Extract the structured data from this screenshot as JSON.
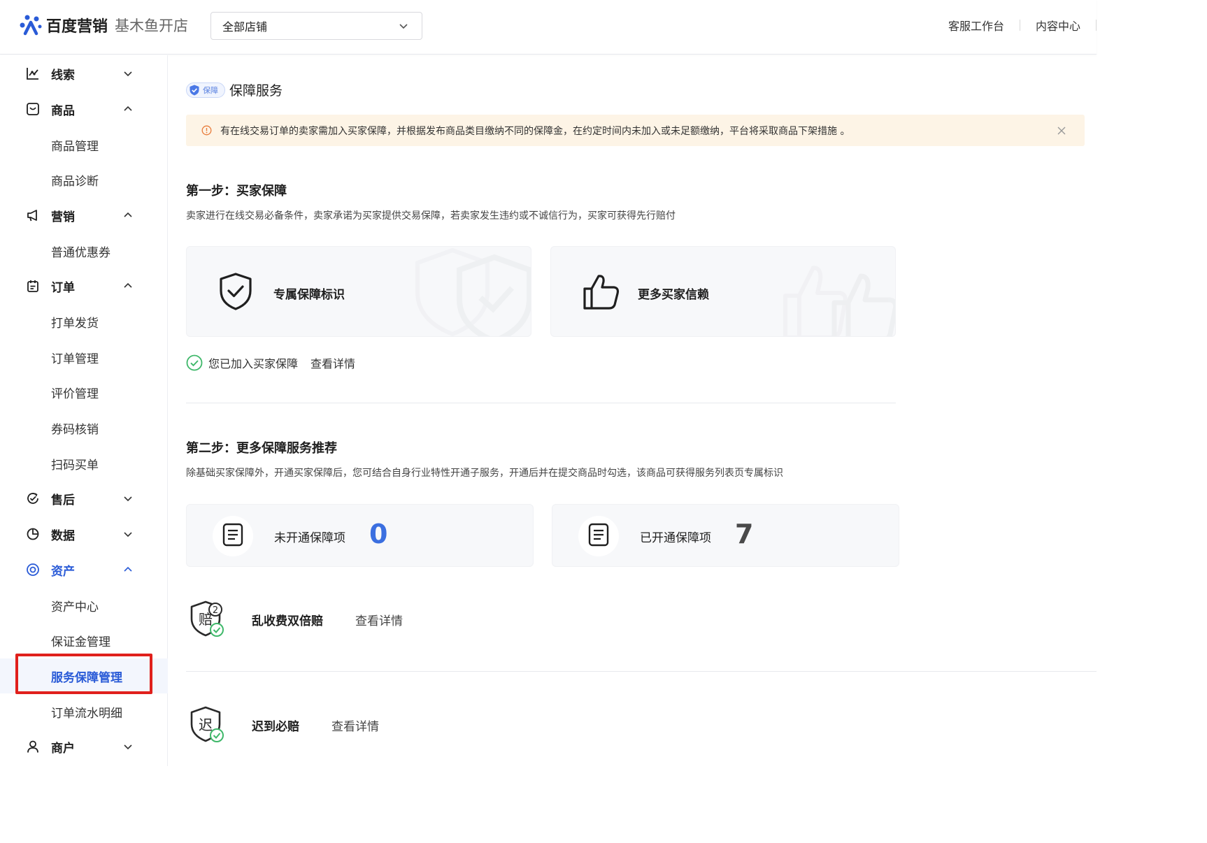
{
  "header": {
    "logo_main": "百度营销",
    "logo_sub": "基木鱼开店",
    "shop_select": "全部店铺",
    "links": [
      "客服工作台",
      "内容中心"
    ]
  },
  "sidebar": {
    "groups": [
      {
        "label": "线索",
        "icon": "chart-line-icon",
        "expanded": false
      },
      {
        "label": "商品",
        "icon": "product-box-icon",
        "expanded": true,
        "items": [
          "商品管理",
          "商品诊断"
        ]
      },
      {
        "label": "营销",
        "icon": "megaphone-icon",
        "expanded": true,
        "items": [
          "普通优惠券"
        ]
      },
      {
        "label": "订单",
        "icon": "order-clipboard-icon",
        "expanded": true,
        "items": [
          "打单发货",
          "订单管理",
          "评价管理",
          "券码核销",
          "扫码买单"
        ]
      },
      {
        "label": "售后",
        "icon": "after-sale-icon",
        "expanded": false
      },
      {
        "label": "数据",
        "icon": "pie-chart-icon",
        "expanded": false
      },
      {
        "label": "资产",
        "icon": "asset-icon",
        "expanded": true,
        "active": true,
        "items": [
          "资产中心",
          "保证金管理",
          "服务保障管理",
          "订单流水明细"
        ]
      },
      {
        "label": "商户",
        "icon": "user-icon",
        "expanded": false
      }
    ],
    "selected_item": "服务保障管理"
  },
  "main": {
    "title_badge": "保障",
    "title": "保障服务",
    "notice": "有在线交易订单的卖家需加入买家保障，并根据发布商品类目缴纳不同的保障金，在约定时间内未加入或未足额缴纳，平台将采取商品下架措施 。",
    "step1": {
      "title": "第一步：买家保障",
      "desc": "卖家进行在线交易必备条件，卖家承诺为买家提供交易保障，若卖家发生违约或不诚信行为，买家可获得先行赔付",
      "cards": [
        {
          "label": "专属保障标识",
          "icon": "shield-check-icon"
        },
        {
          "label": "更多买家信赖",
          "icon": "thumbs-up-icon"
        }
      ],
      "joined_text": "您已加入买家保障",
      "details_link": "查看详情"
    },
    "step2": {
      "title": "第二步：更多保障服务推荐",
      "desc": "除基础买家保障外，开通买家保障后，您可结合自身行业特性开通子服务，开通后并在提交商品时勾选，该商品可获得服务列表页专属标识",
      "stats": [
        {
          "label": "未开通保障项",
          "value": "0",
          "color": "#3b6fe0"
        },
        {
          "label": "已开通保障项",
          "value": "7",
          "color": "#4a4a4a"
        }
      ],
      "services": [
        {
          "name": "乱收费双倍赔",
          "link": "查看详情",
          "icon_char": "赔",
          "icon_badge": "2"
        },
        {
          "name": "迟到必赔",
          "link": "查看详情",
          "icon_char": "迟"
        }
      ]
    }
  }
}
